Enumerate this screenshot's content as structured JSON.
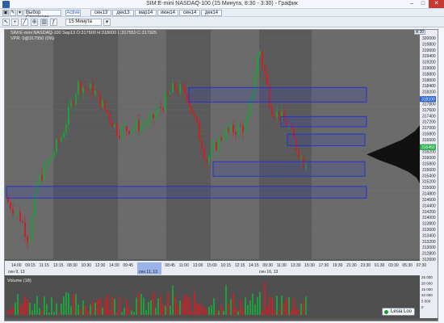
{
  "window": {
    "title": "SIM:E-mini NASDAQ-100 (15 Минута, 8:30 - 3:30) - График",
    "minimize": "–",
    "maximize": "□",
    "close": "✕"
  },
  "toolbar": {
    "strategy_label": "Выбор Стратегии",
    "active_tab": "Active",
    "tabs": [
      "сен13",
      "дек13",
      "мар14",
      "июн14",
      "сен14",
      "дек14"
    ]
  },
  "toolbar2": {
    "interval": "15 Минута"
  },
  "chart_header": {
    "symbol_line": "SIM:E-mini NASDAQ-100 Sep13 O:317600 H:318000 L:317550 C:317925",
    "vpr_line": "VPR: 0@317950 (0%)",
    "close_button": "A:30"
  },
  "price_axis": {
    "labels": [
      "320000",
      "319800",
      "319600",
      "319400",
      "319200",
      "319000",
      "318800",
      "318600",
      "318400",
      "318200",
      "318000",
      "317800",
      "317600",
      "317400",
      "317200",
      "317000",
      "316800",
      "316600",
      "316400",
      "316200",
      "316000",
      "315800",
      "315600",
      "315400",
      "315200",
      "315000",
      "314800",
      "314600",
      "314400",
      "314200",
      "314000",
      "313800",
      "313600",
      "313400",
      "313200",
      "313000",
      "312800",
      "312600"
    ],
    "current_price": "316450",
    "highlight_price": "318100"
  },
  "time_axis": {
    "labels": [
      "14:00",
      "09:15",
      "11:15",
      "13:15",
      "08:30",
      "10:30",
      "12:30",
      "14:30",
      "09:45",
      "11:45",
      "13:45",
      "08:45",
      "11:00",
      "13:00",
      "15:00",
      "10:15",
      "12:15",
      "14:15",
      "09:30",
      "11:30",
      "13:30",
      "15:30",
      "17:30",
      "19:30",
      "21:30",
      "23:30",
      "01:30",
      "03:30",
      "05:30",
      "07:30"
    ],
    "date_labels": [
      "сен 9, 13",
      "сен 11, 13",
      "сен 16, 13"
    ]
  },
  "volume": {
    "label": "Volume (18)",
    "axis_labels": [
      "25 000",
      "20 000",
      "15 000",
      "10 000",
      "5 000",
      "0"
    ]
  },
  "status_badge": {
    "label": "Lesia Loo"
  },
  "colors": {
    "up_bar": "#1e9e3c",
    "down_bar": "#c2242a",
    "zone_border": "#1f2fd6",
    "zone_fill": "rgba(50,60,200,0.18)",
    "profile": "#111111",
    "chart_bg": "#5a5a5a",
    "session_light": "#6b6b6b"
  },
  "chart_data": {
    "type": "candlestick",
    "ylim": [
      312600,
      320200
    ],
    "zones": [
      {
        "y_top": 318500,
        "y_bottom": 318000
      },
      {
        "y_top": 317500,
        "y_bottom": 317150
      },
      {
        "y_top": 316900,
        "y_bottom": 316500
      },
      {
        "y_top": 315950,
        "y_bottom": 315450
      },
      {
        "y_top": 315100,
        "y_bottom": 314700
      }
    ]
  }
}
